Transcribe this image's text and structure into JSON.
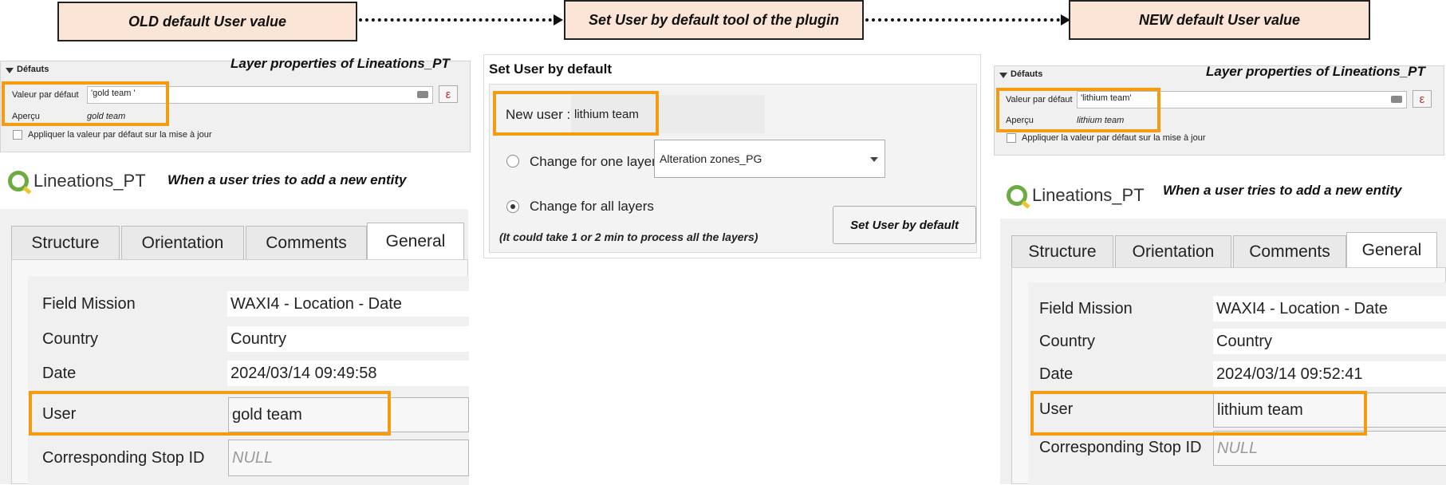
{
  "headers": {
    "old": "OLD default User value",
    "tool": "Set User by default tool of the plugin",
    "new": "NEW default User value"
  },
  "left": {
    "props_note": "Layer properties of Lineations_PT",
    "section": "Défauts",
    "default_label": "Valeur par défaut",
    "default_value": "'gold team '",
    "preview_label": "Aperçu",
    "preview_value": "gold team",
    "apply_label": "Appliquer la valeur par défaut sur la mise à jour",
    "layer_title": "Lineations_PT",
    "entity_note": "When a user tries to add a new entity",
    "tabs": [
      "Structure",
      "Orientation",
      "Comments",
      "General"
    ],
    "fields": {
      "mission_label": "Field Mission",
      "mission_value": "WAXI4 - Location - Date",
      "country_label": "Country",
      "country_value": "Country",
      "date_label": "Date",
      "date_value": "2024/03/14 09:49:58",
      "user_label": "User",
      "user_value": "gold team",
      "stop_label": "Corresponding Stop ID",
      "stop_value": "NULL"
    }
  },
  "plugin": {
    "title": "Set User by default",
    "new_user_label": "New user :",
    "new_user_value": "lithium team",
    "one_layer_label": "Change for one layer :",
    "layer_combo": "Alteration zones_PG",
    "all_layers_label": "Change for all layers",
    "note": "(It could take 1 or 2 min to process all the layers)",
    "button": "Set User by default"
  },
  "right": {
    "props_note": "Layer properties of Lineations_PT",
    "section": "Défauts",
    "default_label": "Valeur par défaut",
    "default_value": "'lithium team'",
    "preview_label": "Aperçu",
    "preview_value": "lithium team",
    "apply_label": "Appliquer la valeur par défaut sur la mise à jour",
    "layer_title": "Lineations_PT",
    "entity_note": "When a user tries to add a new entity",
    "tabs": [
      "Structure",
      "Orientation",
      "Comments",
      "General"
    ],
    "fields": {
      "mission_label": "Field Mission",
      "mission_value": "WAXI4 - Location - Date",
      "country_label": "Country",
      "country_value": "Country",
      "date_label": "Date",
      "date_value": "2024/03/14 09:52:41",
      "user_label": "User",
      "user_value": "lithium team",
      "stop_label": "Corresponding Stop ID",
      "stop_value": "NULL"
    }
  },
  "colors": {
    "highlight": "#f39c12",
    "header_fill": "#fbe5d6"
  },
  "icons": [
    "qgis-logo-icon",
    "clear-icon",
    "expression-icon",
    "collapse-triangle-icon",
    "dropdown-caret-icon"
  ]
}
